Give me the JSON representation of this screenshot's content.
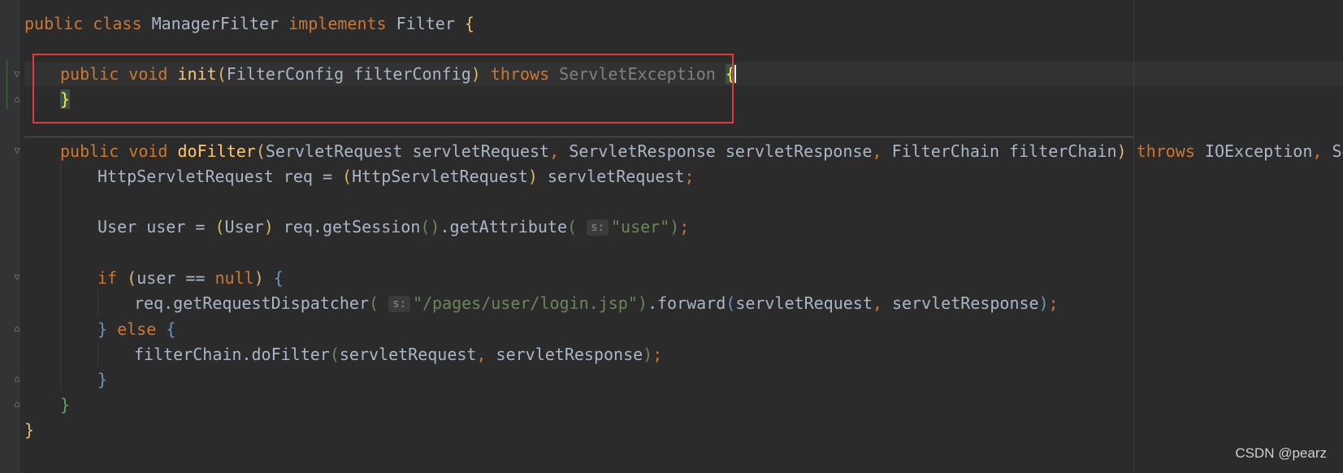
{
  "code": {
    "l1_public": "public",
    "l1_class": "class",
    "l1_name": "ManagerFilter",
    "l1_implements": "implements",
    "l1_iface": "Filter",
    "l1_brace": "{",
    "l2_public": "public",
    "l2_void": "void",
    "l2_fn": "init",
    "l2_params": "FilterConfig filterConfig",
    "l2_throws": "throws",
    "l2_exc": "ServletException",
    "l2_brace": "{",
    "l3_brace": "}",
    "l4_public": "public",
    "l4_void": "void",
    "l4_fn": "doFilter",
    "l4_p1": "ServletRequest servletRequest",
    "l4_p2": "ServletResponse servletResponse",
    "l4_p3": "FilterChain filterChain",
    "l4_throws": "throws",
    "l4_exc1": "IOException",
    "l4_exc2": "Se",
    "l5_text": "HttpServletRequest req = ",
    "l5_cast": "HttpServletRequest",
    "l5_rest": " servletRequest",
    "l6_a": "User user = ",
    "l6_cast": "User",
    "l6_b": " req.getSession",
    "l6_c": ".getAttribute",
    "l6_hint": "s:",
    "l6_str": "\"user\"",
    "l7_if": "if",
    "l7_cond": "user == ",
    "l7_null": "null",
    "l8_call": "req.getRequestDispatcher",
    "l8_hint": "s:",
    "l8_str": "\"/pages/user/login.jsp\"",
    "l8_fwd": ".forward",
    "l8_args1": "servletRequest",
    "l8_args2": " servletResponse",
    "l9_else": "else",
    "l10_call": "filterChain.doFilter",
    "l10_args1": "servletRequest",
    "l10_args2": " servletResponse",
    "l13_brace": "}"
  },
  "watermark": "CSDN @pearz"
}
